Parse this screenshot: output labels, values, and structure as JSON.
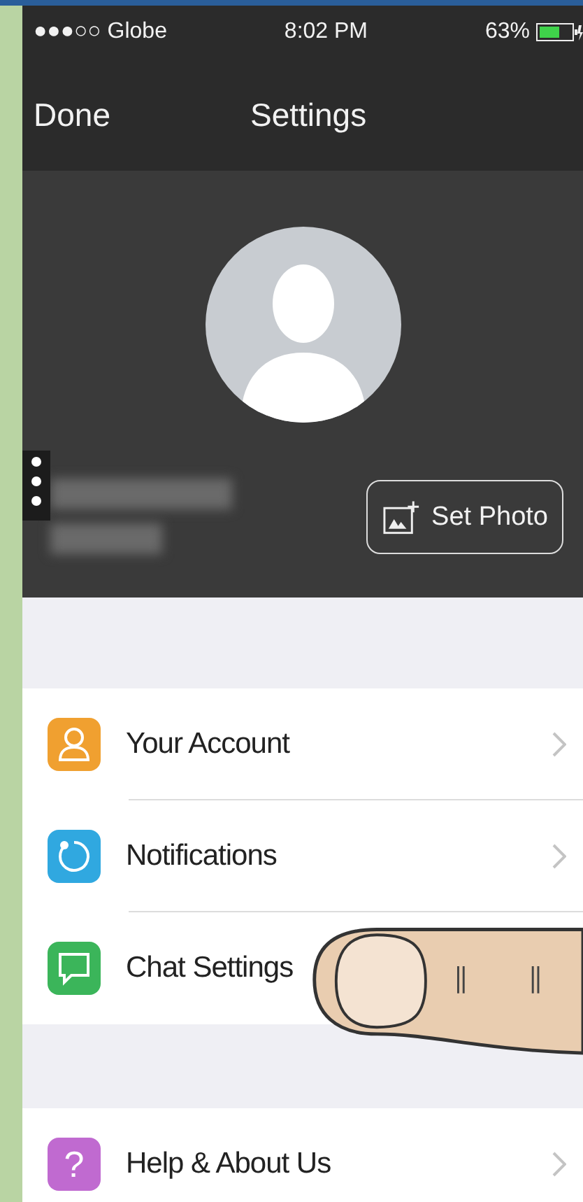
{
  "status_bar": {
    "carrier": "●●●○○ Globe",
    "time": "8:02 PM",
    "battery": "63%"
  },
  "nav": {
    "left": "Done",
    "title": "Settings"
  },
  "profile": {
    "set_photo": "Set Photo"
  },
  "sections": [
    {
      "items": [
        {
          "kind": "person",
          "label": "Your Account",
          "color": "#f0a030",
          "chevron": true
        },
        {
          "kind": "notification",
          "label": "Notifications",
          "color": "#30a8e0",
          "chevron": true
        },
        {
          "kind": "chat",
          "label": "Chat Settings",
          "color": "#3bb55a",
          "chevron": false
        }
      ]
    },
    {
      "items": [
        {
          "kind": "help",
          "label": "Help & About Us",
          "color": "#c06ad0",
          "chevron": true,
          "glyph": "?"
        }
      ]
    }
  ]
}
